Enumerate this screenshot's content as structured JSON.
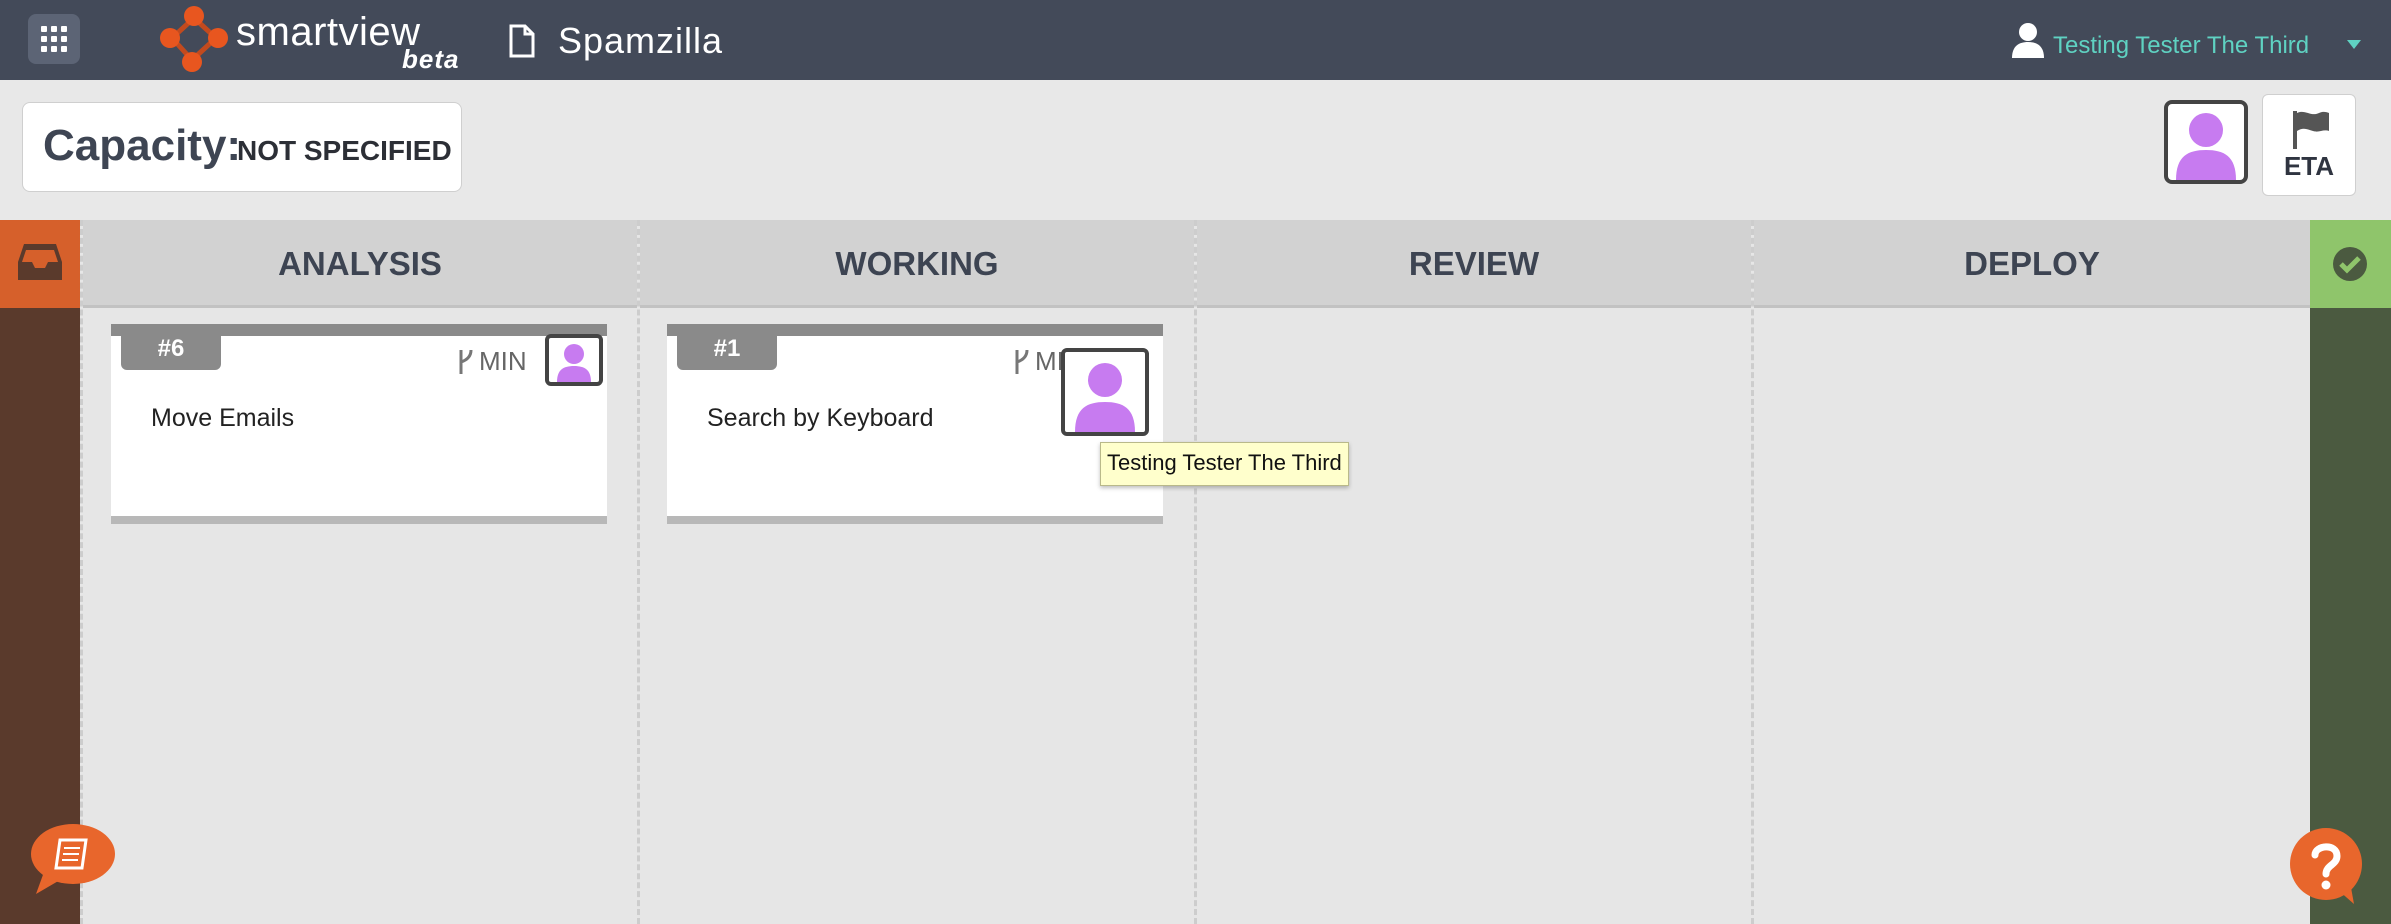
{
  "header": {
    "brand": "smartview",
    "brand_tag": "beta",
    "project_name": "Spamzilla",
    "user_name": "Testing Tester The Third"
  },
  "capacity": {
    "label": "Capacity:",
    "value": "NOT SPECIFIED"
  },
  "toolbar": {
    "eta_label": "ETA"
  },
  "columns": [
    {
      "name": "ANALYSIS"
    },
    {
      "name": "WORKING"
    },
    {
      "name": "REVIEW"
    },
    {
      "name": "DEPLOY"
    }
  ],
  "cards": [
    {
      "id": "#6",
      "size": "MIN",
      "title": "Move Emails",
      "column": "ANALYSIS"
    },
    {
      "id": "#1",
      "size": "MIN",
      "title": "Search by Keyboard",
      "column": "WORKING"
    }
  ],
  "tooltip": "Testing Tester The Third",
  "icons": {
    "apps": "grid-icon",
    "logo": "smartview-logo",
    "project": "document-icon",
    "user": "user-icon",
    "dropdown": "caret-down-icon",
    "eta": "flag-icon",
    "backlog": "inbox-icon",
    "done": "check-circle-icon",
    "size": "branch-icon",
    "guide": "book-chat-icon",
    "help": "question-chat-icon"
  },
  "colors": {
    "topbar": "#434a59",
    "user_name": "#5fd2c2",
    "backlog_head": "#d6602b",
    "backlog_lane": "#5a3a2c",
    "done_head": "#8fc56b",
    "done_lane": "#4b5a40",
    "avatar": "#c77bf0",
    "tooltip": "#ffffcc"
  }
}
